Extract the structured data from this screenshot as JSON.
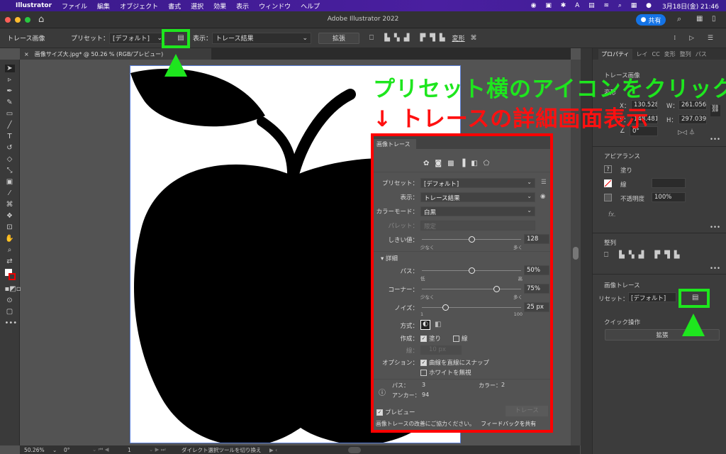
{
  "menubar": {
    "app": "Illustrator",
    "items": [
      "ファイル",
      "編集",
      "オブジェクト",
      "書式",
      "選択",
      "効果",
      "表示",
      "ウィンドウ",
      "ヘルプ"
    ],
    "clock": "3月18日(金) 21:46"
  },
  "titlebar": {
    "title": "Adobe Illustrator 2022",
    "share": "共有"
  },
  "control": {
    "mode": "トレース画像",
    "preset_label": "プリセット：",
    "preset_value": "[デフォルト]",
    "view_label": "表示：",
    "view_value": "トレース結果",
    "expand": "拡張",
    "transform": "変形"
  },
  "document_tab": {
    "close": "×",
    "title": "画像サイズ大.jpg* @ 50.26 % (RGB/プレビュー)"
  },
  "annotation": {
    "line1": "プリセット横のアイコンをクリック",
    "line2": "↓ トレースの詳細画面表示"
  },
  "trace_panel": {
    "tab": "画像トレース",
    "preset_label": "プリセット：",
    "preset": "[デフォルト]",
    "view_label": "表示：",
    "view": "トレース結果",
    "colormode_label": "カラーモード：",
    "colormode": "白黒",
    "palette_label": "パレット：",
    "palette": "限定",
    "threshold_label": "しきい値：",
    "threshold": "128",
    "threshold_fraction": 0.5,
    "threshold_min": "少なく",
    "threshold_max": "多く",
    "advanced": "詳細",
    "paths_label": "パス：",
    "paths": "50%",
    "paths_fraction": 0.5,
    "paths_min": "低",
    "paths_max": "高",
    "corners_label": "コーナー：",
    "corners": "75%",
    "corners_fraction": 0.75,
    "corners_min": "少なく",
    "corners_max": "多く",
    "noise_label": "ノイズ：",
    "noise": "25 px",
    "noise_fraction": 0.24,
    "noise_min": "1",
    "noise_max": "100",
    "method_label": "方式：",
    "create_label": "作成：",
    "fill": "塗り",
    "stroke": "線",
    "stroke_label": "線：",
    "stroke_value": "10 px",
    "options_label": "オプション：",
    "snap": "曲線を直線にスナップ",
    "ignore_white": "ホワイトを無視",
    "info_paths_label": "パス：",
    "info_paths": "3",
    "info_colors_label": "カラー：",
    "info_colors": "2",
    "info_anchors_label": "アンカー：",
    "info_anchors": "94",
    "preview": "プレビュー",
    "trace_button": "トレース",
    "feedback_text": "画像トレースの改善にご協力ください。",
    "feedback_link": "フィードバックを共有"
  },
  "properties": {
    "tabs": [
      "プロパティ",
      "レイ",
      "CC",
      "変形",
      "整列",
      "パス"
    ],
    "section_title": "トレース画像",
    "transform": "変形",
    "x_label": "X：",
    "x": "130.528",
    "w_label": "W：",
    "w": "261.056",
    "y_label": "Y：",
    "y": "148.481",
    "h_label": "H：",
    "h": "297.039",
    "angle": "0°",
    "appearance": "アピアランス",
    "fill": "塗り",
    "stroke": "線",
    "opacity_label": "不透明度",
    "opacity": "100%",
    "fx": "fx.",
    "align": "整列",
    "image_trace": "画像トレース",
    "preset_label": "リセット：",
    "preset": "[デフォルト]",
    "quick_actions": "クイック操作",
    "expand": "拡張"
  },
  "status": {
    "zoom": "50.26%",
    "rotate": "0°",
    "artboard": "1",
    "tool_hint": "ダイレクト選択ツールを切り換え"
  },
  "colors": {
    "highlight_green": "#1ee61e",
    "highlight_red": "#ff0000"
  }
}
